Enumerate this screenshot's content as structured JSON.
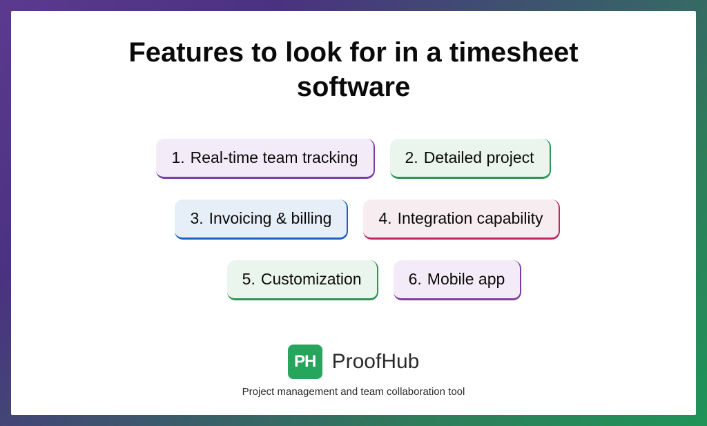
{
  "title": "Features to look for in a timesheet software",
  "features": [
    {
      "num": "1.",
      "label": "Real-time team tracking",
      "color": "purple"
    },
    {
      "num": "2.",
      "label": "Detailed project",
      "color": "green"
    },
    {
      "num": "3.",
      "label": "Invoicing & billing",
      "color": "blue"
    },
    {
      "num": "4.",
      "label": "Integration capability",
      "color": "pink"
    },
    {
      "num": "5.",
      "label": "Customization",
      "color": "green"
    },
    {
      "num": "6.",
      "label": "Mobile app",
      "color": "purple"
    }
  ],
  "footer": {
    "logo_mark": "PH",
    "logo_text": "ProofHub",
    "tagline": "Project management and team collaboration tool"
  }
}
